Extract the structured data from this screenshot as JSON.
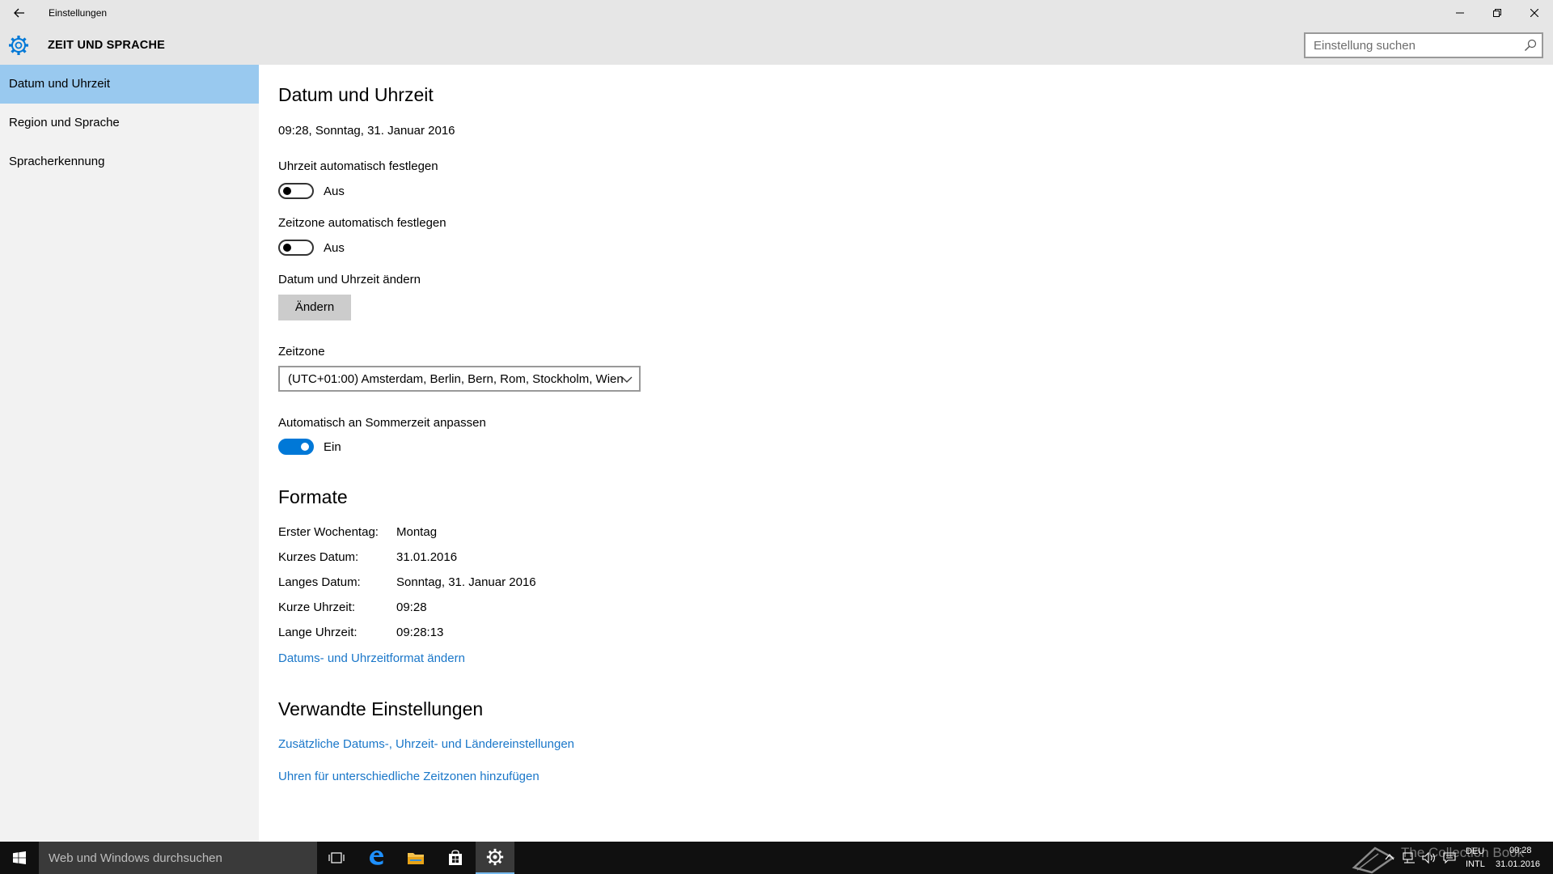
{
  "window": {
    "title": "Einstellungen",
    "controls": [
      "minimize-icon",
      "restore-icon",
      "close-icon"
    ]
  },
  "header": {
    "section_title": "ZEIT UND SPRACHE",
    "search_placeholder": "Einstellung suchen"
  },
  "sidebar": {
    "items": [
      {
        "label": "Datum und Uhrzeit",
        "active": true
      },
      {
        "label": "Region und Sprache",
        "active": false
      },
      {
        "label": "Spracherkennung",
        "active": false
      }
    ]
  },
  "main": {
    "title": "Datum und Uhrzeit",
    "current_datetime": "09:28, Sonntag, 31. Januar 2016",
    "auto_time": {
      "label": "Uhrzeit automatisch festlegen",
      "state": "Aus",
      "on": false
    },
    "auto_timezone": {
      "label": "Zeitzone automatisch festlegen",
      "state": "Aus",
      "on": false
    },
    "change": {
      "label": "Datum und Uhrzeit ändern",
      "button": "Ändern"
    },
    "timezone": {
      "label": "Zeitzone",
      "value": "(UTC+01:00) Amsterdam, Berlin, Bern, Rom, Stockholm, Wien"
    },
    "dst": {
      "label": "Automatisch an Sommerzeit anpassen",
      "state": "Ein",
      "on": true
    },
    "formats": {
      "title": "Formate",
      "rows": [
        {
          "key": "Erster Wochentag:",
          "value": "Montag"
        },
        {
          "key": "Kurzes Datum:",
          "value": "31.01.2016"
        },
        {
          "key": "Langes Datum:",
          "value": "Sonntag, 31. Januar 2016"
        },
        {
          "key": "Kurze Uhrzeit:",
          "value": "09:28"
        },
        {
          "key": "Lange Uhrzeit:",
          "value": "09:28:13"
        }
      ],
      "link": "Datums- und Uhrzeitformat ändern"
    },
    "related": {
      "title": "Verwandte Einstellungen",
      "links": [
        "Zusätzliche Datums-, Uhrzeit- und Ländereinstellungen",
        "Uhren für unterschiedliche Zeitzonen hinzufügen"
      ]
    }
  },
  "taskbar": {
    "search_placeholder": "Web und Windows durchsuchen",
    "language": "DEU",
    "layout": "INTL",
    "time": "09:28",
    "date": "31.01.2016",
    "watermark": "The Collection Book"
  },
  "colors": {
    "accent": "#0078d7",
    "link": "#1a77c9",
    "nav_active": "#99c9ef",
    "sidebar_bg": "#f2f2f2",
    "titlebar_bg": "#e6e6e6",
    "taskbar_bg": "#101010"
  }
}
